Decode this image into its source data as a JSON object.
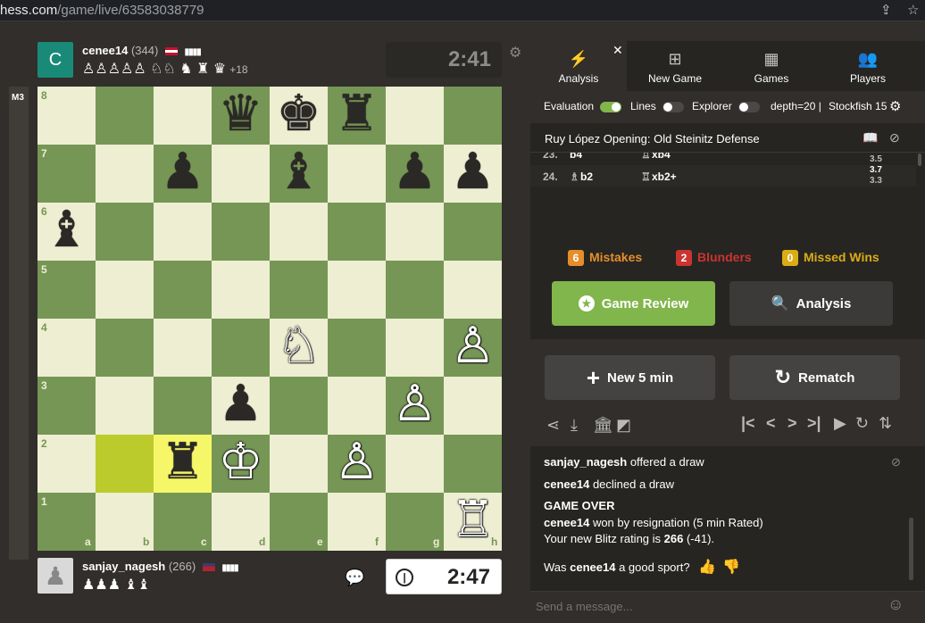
{
  "browser": {
    "url_host": "hess.com",
    "url_path": "/game/live/63583038779"
  },
  "eval_badge": "M3",
  "top_player": {
    "avatar_letter": "C",
    "name": "cenee14",
    "rating": "(344)",
    "captured": "♙♙♙♙♙ ♘♘ ♞ ♜ ♛",
    "material": "+18",
    "clock": "2:41"
  },
  "bottom_player": {
    "name": "sanjay_nagesh",
    "rating": "(266)",
    "captured": "♟♟♟ ♝♝",
    "clock": "2:47"
  },
  "board": {
    "ranks": [
      "8",
      "7",
      "6",
      "5",
      "4",
      "3",
      "2",
      "1"
    ],
    "files": [
      "a",
      "b",
      "c",
      "d",
      "e",
      "f",
      "g",
      "h"
    ],
    "highlighted": [
      "b2",
      "c2"
    ],
    "pieces": [
      {
        "sq": "d8",
        "p": "q",
        "c": "b"
      },
      {
        "sq": "e8",
        "p": "k",
        "c": "b"
      },
      {
        "sq": "f8",
        "p": "r",
        "c": "b"
      },
      {
        "sq": "c7",
        "p": "p",
        "c": "b"
      },
      {
        "sq": "e7",
        "p": "b",
        "c": "b"
      },
      {
        "sq": "g7",
        "p": "p",
        "c": "b"
      },
      {
        "sq": "h7",
        "p": "p",
        "c": "b"
      },
      {
        "sq": "a6",
        "p": "b",
        "c": "b"
      },
      {
        "sq": "e4",
        "p": "n",
        "c": "w"
      },
      {
        "sq": "h4",
        "p": "p",
        "c": "w"
      },
      {
        "sq": "d3",
        "p": "p",
        "c": "b"
      },
      {
        "sq": "g3",
        "p": "p",
        "c": "w"
      },
      {
        "sq": "c2",
        "p": "r",
        "c": "b"
      },
      {
        "sq": "d2",
        "p": "k",
        "c": "w"
      },
      {
        "sq": "f2",
        "p": "p",
        "c": "w"
      },
      {
        "sq": "h1",
        "p": "r",
        "c": "w"
      }
    ]
  },
  "panel": {
    "tabs": [
      {
        "label": "Analysis",
        "icon": "lightning-icon"
      },
      {
        "label": "New Game",
        "icon": "plus-square-icon"
      },
      {
        "label": "Games",
        "icon": "chessboard-icon"
      },
      {
        "label": "Players",
        "icon": "people-icon"
      }
    ],
    "settings": {
      "evaluation_label": "Evaluation",
      "lines_label": "Lines",
      "explorer_label": "Explorer",
      "depth": "depth=20 |",
      "engine": "Stockfish 15"
    },
    "opening": "Ruy López Opening: Old Steinitz Defense",
    "moves": [
      {
        "num": "23.",
        "white": "b4",
        "black": "xb4",
        "evals": [
          "3.5"
        ]
      },
      {
        "num": "24.",
        "white": "b2",
        "black": "xb2+",
        "evals": [
          "3.7",
          "3.3"
        ]
      }
    ],
    "stats": [
      {
        "count": "6",
        "label": "Mistakes",
        "color": "#e58f2a"
      },
      {
        "count": "2",
        "label": "Blunders",
        "color": "#ca3431"
      },
      {
        "count": "0",
        "label": "Missed Wins",
        "color": "#dbac16"
      }
    ],
    "game_review_label": "Game Review",
    "analysis_label": "Analysis",
    "new_game_label": "New 5 min",
    "rematch_label": "Rematch",
    "chat": [
      {
        "user": "sanjay_nagesh",
        "text": " offered a draw"
      },
      {
        "user": "cenee14",
        "text": " declined a draw"
      }
    ],
    "game_over_title": "GAME OVER",
    "result_user": "cenee14",
    "result_text": " won by resignation (5 min Rated)",
    "rating_prefix": "Your new Blitz rating is ",
    "rating_value": "266",
    "rating_change": " (-41).",
    "sport_prefix": "Was ",
    "sport_user": "cenee14",
    "sport_suffix": " a good sport?",
    "message_placeholder": "Send a message..."
  }
}
